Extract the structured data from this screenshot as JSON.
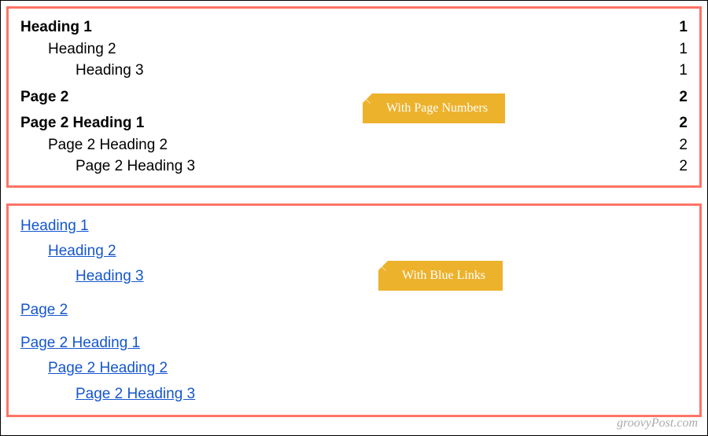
{
  "watermark": "groovyPost.com",
  "panels": {
    "page_numbers": {
      "callout_label": "With Page Numbers",
      "entries": [
        {
          "title": "Heading 1",
          "page": "1",
          "indent": 0,
          "bold": true
        },
        {
          "title": "Heading 2",
          "page": "1",
          "indent": 1,
          "bold": false
        },
        {
          "title": "Heading 3",
          "page": "1",
          "indent": 2,
          "bold": false
        },
        {
          "title": "Page 2",
          "page": "2",
          "indent": 0,
          "bold": true
        },
        {
          "title": "Page 2 Heading 1",
          "page": "2",
          "indent": 0,
          "bold": true
        },
        {
          "title": "Page 2 Heading 2",
          "page": "2",
          "indent": 1,
          "bold": false
        },
        {
          "title": "Page 2 Heading 3",
          "page": "2",
          "indent": 2,
          "bold": false
        }
      ]
    },
    "blue_links": {
      "callout_label": "With Blue Links",
      "entries": [
        {
          "title": "Heading 1",
          "indent": 0
        },
        {
          "title": "Heading 2",
          "indent": 1
        },
        {
          "title": "Heading 3",
          "indent": 2
        },
        {
          "title": "Page 2",
          "indent": 0
        },
        {
          "title": "Page 2 Heading 1",
          "indent": 0
        },
        {
          "title": "Page 2 Heading 2",
          "indent": 1
        },
        {
          "title": "Page 2 Heading 3",
          "indent": 2
        }
      ]
    }
  }
}
